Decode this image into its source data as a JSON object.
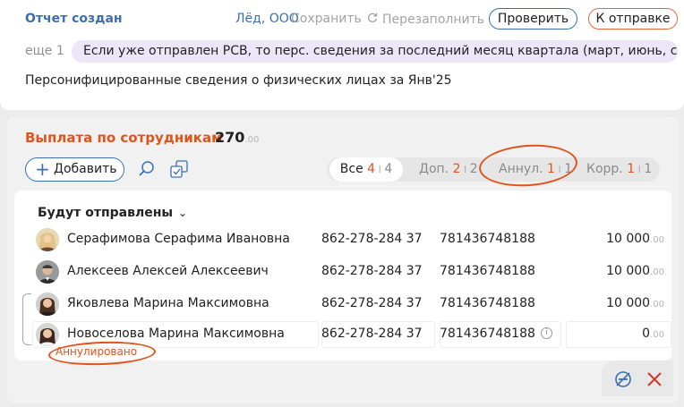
{
  "header": {
    "status": "Отчет создан",
    "org": "Лёд, ООО",
    "save": "Сохранить",
    "refill": "Перезаполнить",
    "check": "Проверить",
    "send": "К отправке"
  },
  "notice": {
    "more": "еще 1",
    "text": "Если уже отправлен РСВ, то перс. сведения за последний месяц квартала (март, июнь, сентя…"
  },
  "report": {
    "title": "Персонифицированные сведения о физических лицах за Янв'25"
  },
  "payments": {
    "title": "Выплата по сотрудникам",
    "total_main": "270",
    "total_kop": ".00",
    "add_label": "Добавить",
    "filters": [
      {
        "label": "Все",
        "count": "4",
        "total": "4"
      },
      {
        "label": "Доп.",
        "count": "2",
        "total": "2"
      },
      {
        "label": "Аннул.",
        "count": "1",
        "total": "1"
      },
      {
        "label": "Корр.",
        "count": "1",
        "total": "1"
      }
    ],
    "group_title": "Будут отправлены",
    "rows": [
      {
        "name": "Серафимова Серафима Ивановна",
        "snils": "862-278-284 37",
        "inn": "781436748188",
        "amount": "10 000",
        "kop": ".00"
      },
      {
        "name": "Алексеев Алексей Алексеевич",
        "snils": "862-278-284 37",
        "inn": "781436748188",
        "amount": "10 000",
        "kop": ".00"
      },
      {
        "name": "Яковлева Марина Максимовна",
        "snils": "862-278-284 37",
        "inn": "781436748188",
        "amount": "10 000",
        "kop": ".00"
      },
      {
        "name": "Новоселова Марина Максимовна",
        "snils": "862-278-284 37",
        "inn": "781436748188",
        "amount": "0",
        "kop": ".00"
      }
    ],
    "cancelled_label": "Аннулировано"
  },
  "colors": {
    "accent_blue": "#3a6fb5",
    "accent_orange": "#e2531c",
    "notice_bg": "#ebe6f8"
  }
}
